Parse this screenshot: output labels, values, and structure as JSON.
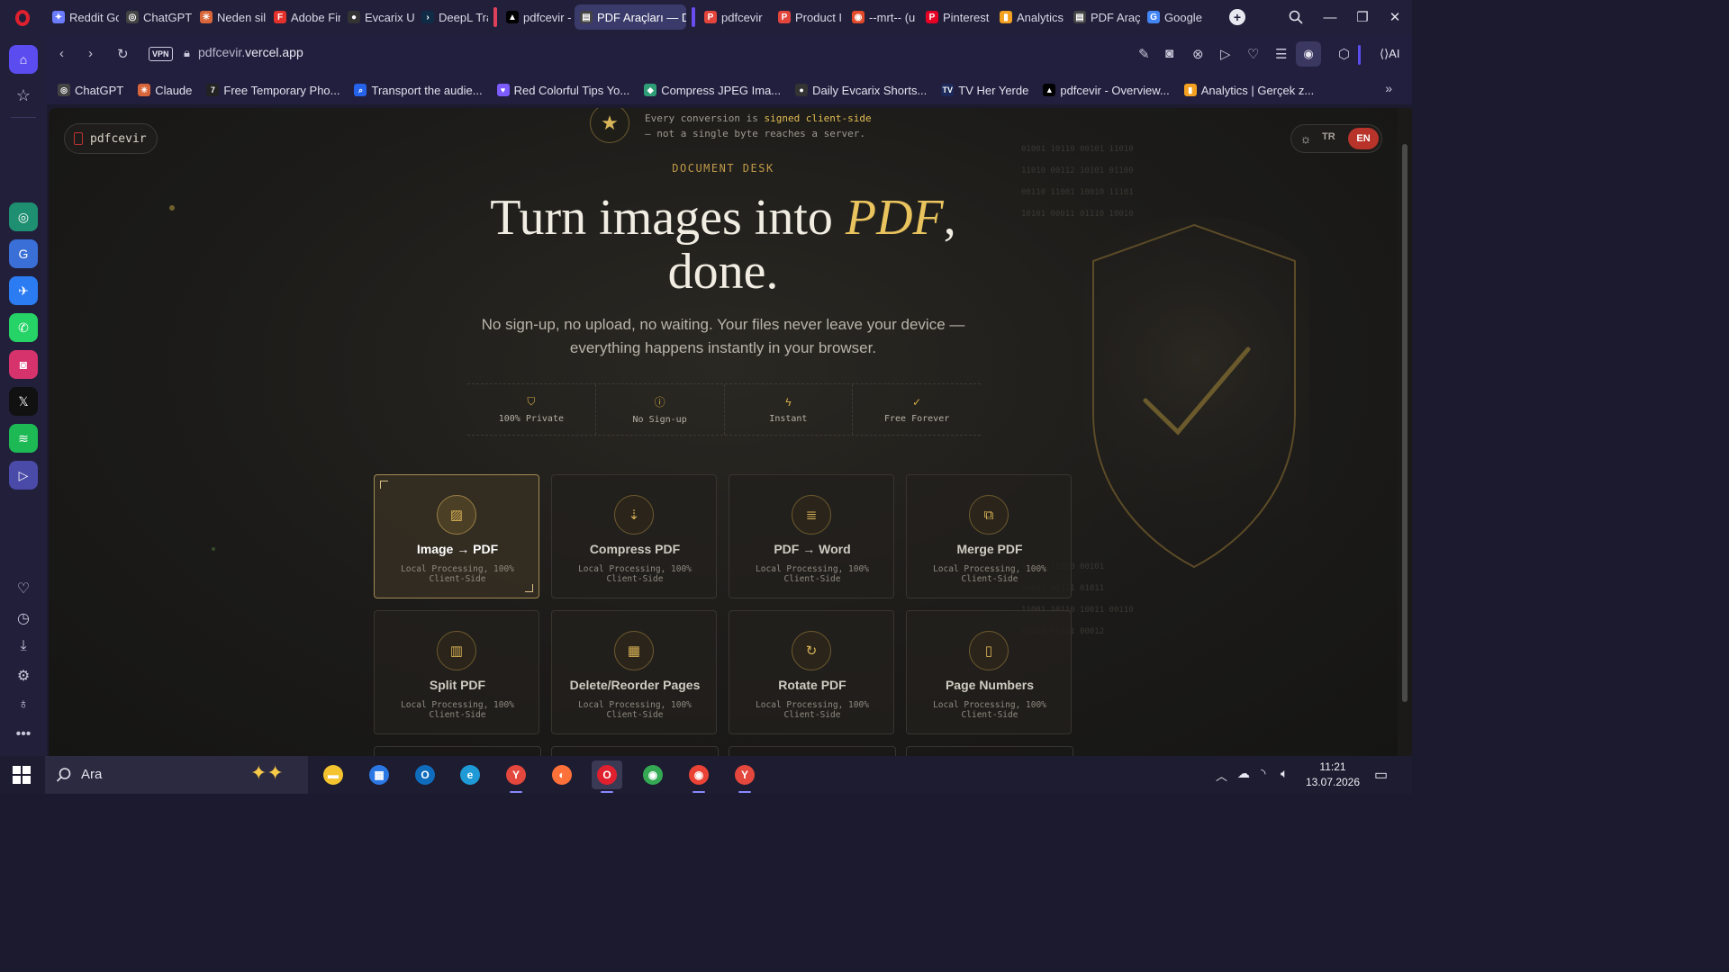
{
  "browser": {
    "tabs": [
      {
        "label": "Reddit Gc",
        "color": "#6b7cff",
        "glyph": "✦"
      },
      {
        "label": "ChatGPT",
        "color": "#444",
        "glyph": "◎"
      },
      {
        "label": "Neden sil",
        "color": "#d9653b",
        "glyph": "✳"
      },
      {
        "label": "Adobe Fir",
        "color": "#e3312b",
        "glyph": "F"
      },
      {
        "label": "Evcarix Ul",
        "color": "#333",
        "glyph": "●"
      },
      {
        "label": "DeepL Tra",
        "color": "#0f2b46",
        "glyph": "›"
      },
      {
        "label": "pdfcevir -",
        "color": "#000",
        "glyph": "▲"
      },
      {
        "label": "PDF Araçları — D",
        "color": "#444",
        "glyph": "▤",
        "active": true
      },
      {
        "label": "pdfcevir",
        "color": "#e2453b",
        "glyph": "P"
      },
      {
        "label": "Product I",
        "color": "#e2453b",
        "glyph": "P"
      },
      {
        "label": "--mrt-- (u",
        "color": "#e24a2a",
        "glyph": "◉"
      },
      {
        "label": "Pinterest",
        "color": "#e60023",
        "glyph": "P"
      },
      {
        "label": "Analytics",
        "color": "#f4a020",
        "glyph": "▮"
      },
      {
        "label": "PDF Araç",
        "color": "#444",
        "glyph": "▤"
      },
      {
        "label": "Google",
        "color": "#4285f4",
        "glyph": "G"
      }
    ],
    "url_prefix": "pdfcevir.",
    "url_domain": "vercel.app",
    "vpn_label": "VPN",
    "ai_label": "AI",
    "bookmarks": [
      {
        "label": "ChatGPT",
        "color": "#444",
        "glyph": "◎"
      },
      {
        "label": "Claude",
        "color": "#d9653b",
        "glyph": "✳"
      },
      {
        "label": "Free Temporary Pho...",
        "color": "#222",
        "glyph": "7"
      },
      {
        "label": "Transport the audie...",
        "color": "#2563eb",
        "glyph": "⌕"
      },
      {
        "label": "Red Colorful Tips Yo...",
        "color": "#7c5cff",
        "glyph": "♥"
      },
      {
        "label": "Compress JPEG Ima...",
        "color": "#2f9e76",
        "glyph": "◆"
      },
      {
        "label": "Daily Evcarix Shorts...",
        "color": "#333",
        "glyph": "●"
      },
      {
        "label": "TV Her Yerde",
        "color": "#1b2a5a",
        "glyph": "TV"
      },
      {
        "label": "pdfcevir - Overview...",
        "color": "#000",
        "glyph": "▲"
      },
      {
        "label": "Analytics | Gerçek z...",
        "color": "#f4a020",
        "glyph": "▮"
      }
    ]
  },
  "page": {
    "logo": "pdfcevir",
    "badge_line1_pre": "Every conversion is ",
    "badge_line1_hl": "signed client-side",
    "badge_line2": "— not a single byte reaches a server.",
    "lang_tr": "TR",
    "lang_en": "EN",
    "kicker": "DOCUMENT DESK",
    "hero_pre": "Turn images into ",
    "hero_accent": "PDF",
    "hero_post": ",",
    "hero_line2": "done.",
    "subtitle": "No sign-up, no upload, no waiting. Your files never leave your device — everything happens instantly in your browser.",
    "stats": [
      {
        "icon": "shield-icon",
        "glyph": "⛉",
        "label": "100% Private"
      },
      {
        "icon": "info-icon",
        "glyph": "ⓘ",
        "label": "No Sign-up"
      },
      {
        "icon": "bolt-icon",
        "glyph": "ϟ",
        "label": "Instant"
      },
      {
        "icon": "check-circle-icon",
        "glyph": "✓",
        "label": "Free Forever"
      }
    ],
    "tools": [
      {
        "title": "Image → PDF",
        "desc": "Local Processing, 100% Client-Side",
        "icon": "image-icon",
        "glyph": "▨",
        "active": true
      },
      {
        "title": "Compress PDF",
        "desc": "Local Processing, 100% Client-Side",
        "icon": "compress-icon",
        "glyph": "⇣"
      },
      {
        "title": "PDF → Word",
        "desc": "Local Processing, 100% Client-Side",
        "icon": "document-icon",
        "glyph": "≣"
      },
      {
        "title": "Merge PDF",
        "desc": "Local Processing, 100% Client-Side",
        "icon": "merge-icon",
        "glyph": "⧉"
      },
      {
        "title": "Split PDF",
        "desc": "Local Processing, 100% Client-Side",
        "icon": "split-icon",
        "glyph": "▥"
      },
      {
        "title": "Delete/Reorder Pages",
        "desc": "Local Processing, 100% Client-Side",
        "icon": "grid-icon",
        "glyph": "▦"
      },
      {
        "title": "Rotate PDF",
        "desc": "Local Processing, 100% Client-Side",
        "icon": "rotate-icon",
        "glyph": "↻"
      },
      {
        "title": "Page Numbers",
        "desc": "Local Processing, 100% Client-Side",
        "icon": "page-number-icon",
        "glyph": "▯"
      }
    ],
    "binary_top": [
      "01001 10110 00101 11010",
      "11010 00112 10101 01100",
      "00110 11001 10010 11101",
      "10101 00011 01110 10010"
    ],
    "binary_bottom": [
      "10110 11010 00101",
      "10011 00111 01011",
      "11001 10110 10011 00110",
      "01010 01101 00012"
    ]
  },
  "taskbar": {
    "search_label": "Ara",
    "time": "11:21",
    "date": "13.07.2026",
    "apps": [
      {
        "name": "file-explorer",
        "color": "#f4c430",
        "glyph": "▬"
      },
      {
        "name": "microsoft-store",
        "color": "#2b78e4",
        "glyph": "▦"
      },
      {
        "name": "outlook",
        "color": "#0f6cbd",
        "glyph": "O"
      },
      {
        "name": "edge",
        "color": "#1f9ad6",
        "glyph": "e"
      },
      {
        "name": "yandex-browser",
        "color": "#e4473d",
        "glyph": "Y"
      },
      {
        "name": "firefox",
        "color": "#ff7139",
        "glyph": "◐"
      },
      {
        "name": "opera",
        "color": "#e0202e",
        "glyph": "O",
        "active": true
      },
      {
        "name": "chrome",
        "color": "#34a853",
        "glyph": "◉"
      },
      {
        "name": "chrome-profile",
        "color": "#ea4335",
        "glyph": "◉"
      },
      {
        "name": "yandex",
        "color": "#e4473d",
        "glyph": "Y"
      }
    ]
  },
  "colors": {
    "accent_gold": "#e9c35d",
    "active_lang": "#b8342a",
    "opera_red": "#e0202e"
  }
}
